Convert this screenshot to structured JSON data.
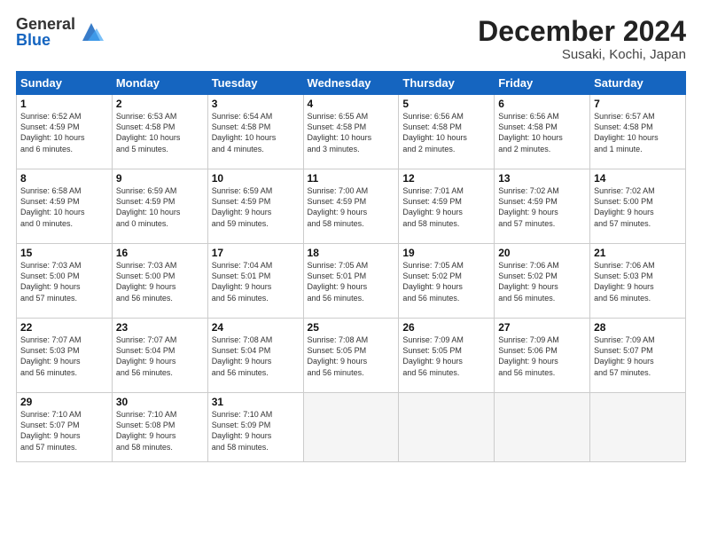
{
  "logo": {
    "general": "General",
    "blue": "Blue"
  },
  "title": "December 2024",
  "subtitle": "Susaki, Kochi, Japan",
  "days_header": [
    "Sunday",
    "Monday",
    "Tuesday",
    "Wednesday",
    "Thursday",
    "Friday",
    "Saturday"
  ],
  "weeks": [
    [
      {
        "day": "1",
        "info": "Sunrise: 6:52 AM\nSunset: 4:59 PM\nDaylight: 10 hours\nand 6 minutes."
      },
      {
        "day": "2",
        "info": "Sunrise: 6:53 AM\nSunset: 4:58 PM\nDaylight: 10 hours\nand 5 minutes."
      },
      {
        "day": "3",
        "info": "Sunrise: 6:54 AM\nSunset: 4:58 PM\nDaylight: 10 hours\nand 4 minutes."
      },
      {
        "day": "4",
        "info": "Sunrise: 6:55 AM\nSunset: 4:58 PM\nDaylight: 10 hours\nand 3 minutes."
      },
      {
        "day": "5",
        "info": "Sunrise: 6:56 AM\nSunset: 4:58 PM\nDaylight: 10 hours\nand 2 minutes."
      },
      {
        "day": "6",
        "info": "Sunrise: 6:56 AM\nSunset: 4:58 PM\nDaylight: 10 hours\nand 2 minutes."
      },
      {
        "day": "7",
        "info": "Sunrise: 6:57 AM\nSunset: 4:58 PM\nDaylight: 10 hours\nand 1 minute."
      }
    ],
    [
      {
        "day": "8",
        "info": "Sunrise: 6:58 AM\nSunset: 4:59 PM\nDaylight: 10 hours\nand 0 minutes."
      },
      {
        "day": "9",
        "info": "Sunrise: 6:59 AM\nSunset: 4:59 PM\nDaylight: 10 hours\nand 0 minutes."
      },
      {
        "day": "10",
        "info": "Sunrise: 6:59 AM\nSunset: 4:59 PM\nDaylight: 9 hours\nand 59 minutes."
      },
      {
        "day": "11",
        "info": "Sunrise: 7:00 AM\nSunset: 4:59 PM\nDaylight: 9 hours\nand 58 minutes."
      },
      {
        "day": "12",
        "info": "Sunrise: 7:01 AM\nSunset: 4:59 PM\nDaylight: 9 hours\nand 58 minutes."
      },
      {
        "day": "13",
        "info": "Sunrise: 7:02 AM\nSunset: 4:59 PM\nDaylight: 9 hours\nand 57 minutes."
      },
      {
        "day": "14",
        "info": "Sunrise: 7:02 AM\nSunset: 5:00 PM\nDaylight: 9 hours\nand 57 minutes."
      }
    ],
    [
      {
        "day": "15",
        "info": "Sunrise: 7:03 AM\nSunset: 5:00 PM\nDaylight: 9 hours\nand 57 minutes."
      },
      {
        "day": "16",
        "info": "Sunrise: 7:03 AM\nSunset: 5:00 PM\nDaylight: 9 hours\nand 56 minutes."
      },
      {
        "day": "17",
        "info": "Sunrise: 7:04 AM\nSunset: 5:01 PM\nDaylight: 9 hours\nand 56 minutes."
      },
      {
        "day": "18",
        "info": "Sunrise: 7:05 AM\nSunset: 5:01 PM\nDaylight: 9 hours\nand 56 minutes."
      },
      {
        "day": "19",
        "info": "Sunrise: 7:05 AM\nSunset: 5:02 PM\nDaylight: 9 hours\nand 56 minutes."
      },
      {
        "day": "20",
        "info": "Sunrise: 7:06 AM\nSunset: 5:02 PM\nDaylight: 9 hours\nand 56 minutes."
      },
      {
        "day": "21",
        "info": "Sunrise: 7:06 AM\nSunset: 5:03 PM\nDaylight: 9 hours\nand 56 minutes."
      }
    ],
    [
      {
        "day": "22",
        "info": "Sunrise: 7:07 AM\nSunset: 5:03 PM\nDaylight: 9 hours\nand 56 minutes."
      },
      {
        "day": "23",
        "info": "Sunrise: 7:07 AM\nSunset: 5:04 PM\nDaylight: 9 hours\nand 56 minutes."
      },
      {
        "day": "24",
        "info": "Sunrise: 7:08 AM\nSunset: 5:04 PM\nDaylight: 9 hours\nand 56 minutes."
      },
      {
        "day": "25",
        "info": "Sunrise: 7:08 AM\nSunset: 5:05 PM\nDaylight: 9 hours\nand 56 minutes."
      },
      {
        "day": "26",
        "info": "Sunrise: 7:09 AM\nSunset: 5:05 PM\nDaylight: 9 hours\nand 56 minutes."
      },
      {
        "day": "27",
        "info": "Sunrise: 7:09 AM\nSunset: 5:06 PM\nDaylight: 9 hours\nand 56 minutes."
      },
      {
        "day": "28",
        "info": "Sunrise: 7:09 AM\nSunset: 5:07 PM\nDaylight: 9 hours\nand 57 minutes."
      }
    ],
    [
      {
        "day": "29",
        "info": "Sunrise: 7:10 AM\nSunset: 5:07 PM\nDaylight: 9 hours\nand 57 minutes."
      },
      {
        "day": "30",
        "info": "Sunrise: 7:10 AM\nSunset: 5:08 PM\nDaylight: 9 hours\nand 58 minutes."
      },
      {
        "day": "31",
        "info": "Sunrise: 7:10 AM\nSunset: 5:09 PM\nDaylight: 9 hours\nand 58 minutes."
      },
      {
        "day": "",
        "info": ""
      },
      {
        "day": "",
        "info": ""
      },
      {
        "day": "",
        "info": ""
      },
      {
        "day": "",
        "info": ""
      }
    ]
  ]
}
